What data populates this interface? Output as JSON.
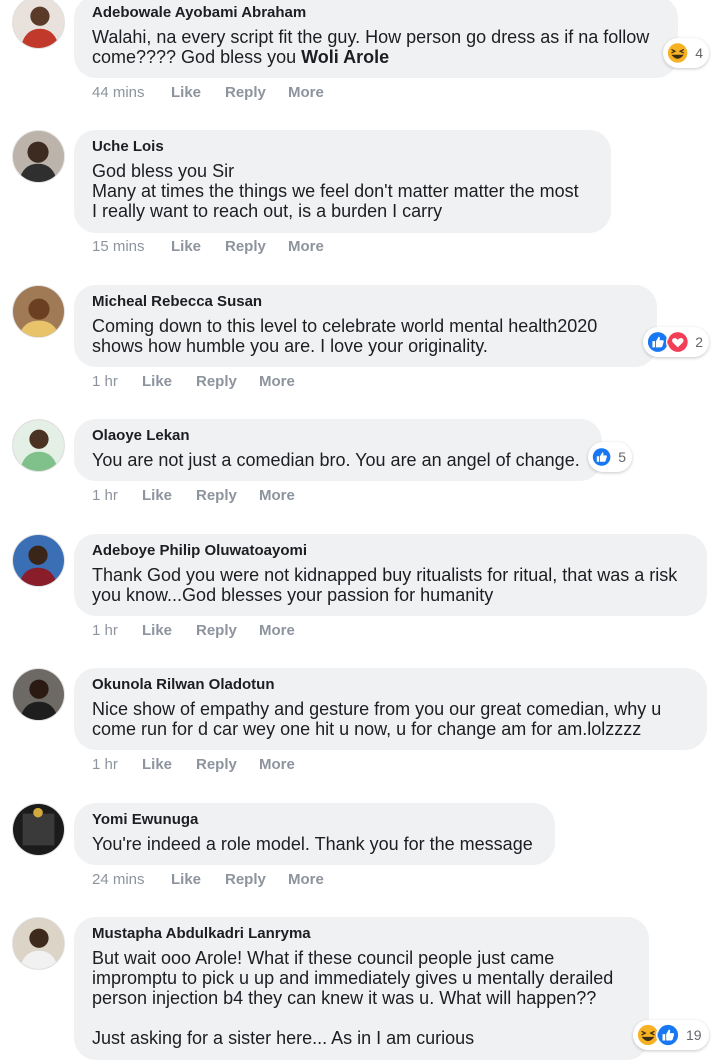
{
  "actions": {
    "like": "Like",
    "reply": "Reply",
    "more": "More"
  },
  "comments": [
    {
      "author": "Adebowale Ayobami Abraham",
      "text": "Walahi, na every script fit the guy. How person go dress as if na follow come???? God bless you ",
      "mention": "Woli Arole",
      "time": "44 mins",
      "reactions": [
        "haha-icon"
      ],
      "reaction_count": "4"
    },
    {
      "author": "Uche Lois",
      "text": "God bless you Sir\nMany at times the things we feel don't matter matter the most\nI really want to reach out, is a burden I carry",
      "time": "15 mins"
    },
    {
      "author": "Micheal Rebecca Susan",
      "text": "Coming down to this level to celebrate world mental health2020\nshows how humble you are. I love your originality.",
      "time": "1 hr",
      "reactions": [
        "like-icon",
        "love-icon"
      ],
      "reaction_count": "2"
    },
    {
      "author": "Olaoye Lekan",
      "text": "You are not just a comedian bro. You are an angel of change.",
      "time": "1 hr",
      "reactions": [
        "like-icon"
      ],
      "reaction_count": "5"
    },
    {
      "author": "Adeboye Philip Oluwatoayomi",
      "text": "Thank God you were not kidnapped buy ritualists for ritual, that was a risk\nyou know...God blesses your passion for humanity",
      "time": "1 hr"
    },
    {
      "author": "Okunola Rilwan Oladotun",
      "text": "Nice show of empathy and gesture from you our great comedian, why u\ncome run for d car wey one hit u now, u for change am for am.lolzzzz",
      "time": "1 hr"
    },
    {
      "author": "Yomi Ewunuga",
      "text": "You're indeed a role model. Thank you for the message",
      "time": "24 mins"
    },
    {
      "author": "Mustapha Abdulkadri Lanryma",
      "text": "But wait ooo Arole! What if these council people just came\nimpromptu to pick u up and immediately gives u mentally derailed\nperson injection b4 they can knew it was u. What will happen??\n\nJust asking for a sister here... As in I am curious",
      "reactions": [
        "haha-icon",
        "like-icon"
      ],
      "reaction_count": "19"
    }
  ],
  "colors": {
    "bubble": "#eff1f3",
    "action_text": "#8d949e",
    "like_blue": "#1877f2",
    "love_red": "#f33e58",
    "haha_yellow": "#f7b125"
  }
}
